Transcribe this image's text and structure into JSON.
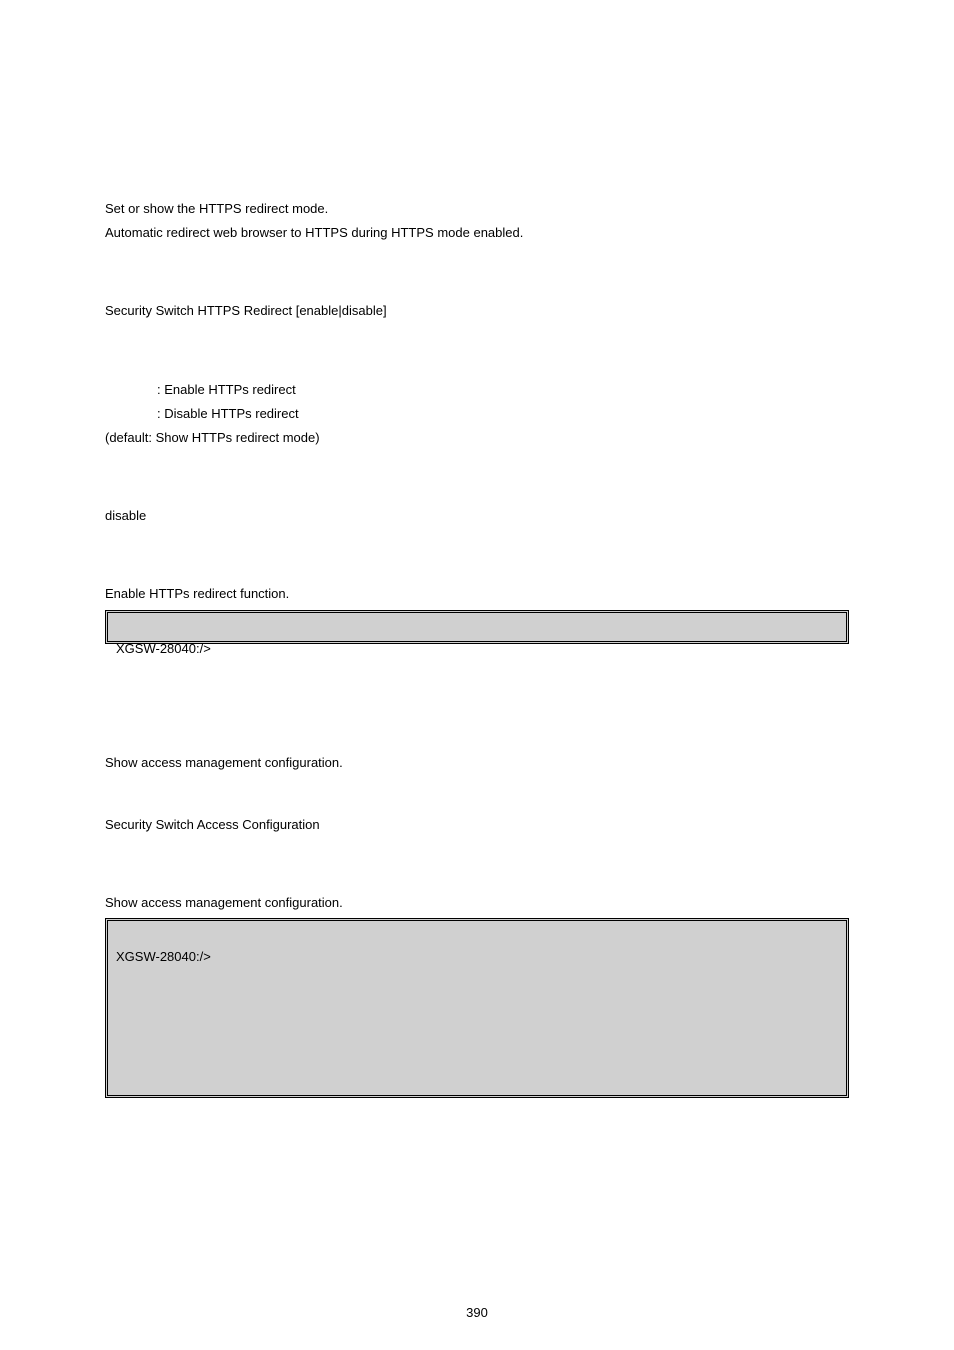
{
  "section1": {
    "desc_line1": "Set or show the HTTPS redirect mode.",
    "desc_line2": "Automatic redirect web browser to HTTPS during HTTPS mode enabled.",
    "syntax": "Security Switch HTTPS Redirect [enable|disable]",
    "param_enable": ": Enable HTTPs redirect",
    "param_disable": ": Disable HTTPs redirect",
    "param_default": "(default: Show HTTPs redirect mode)",
    "default_setting": "disable",
    "example_intro": "Enable HTTPs redirect function.",
    "example_prompt": "XGSW-28040:/>"
  },
  "section2": {
    "desc": "Show access management configuration.",
    "syntax": "Security Switch Access Configuration",
    "example_intro": "Show access management configuration.",
    "example_prompt": "XGSW-28040:/>"
  },
  "page_number": "390"
}
